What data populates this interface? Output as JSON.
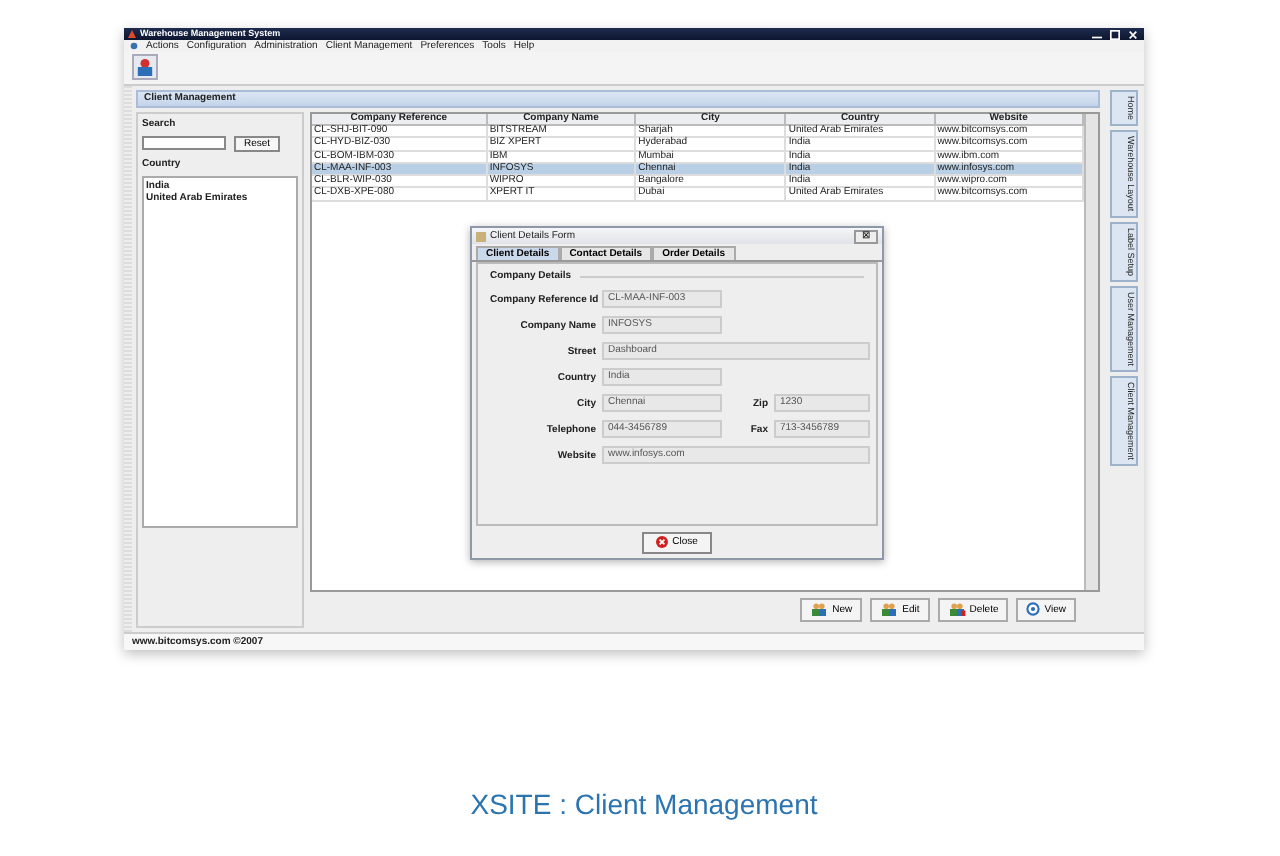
{
  "window": {
    "title": "Warehouse Management System"
  },
  "menu": [
    "Actions",
    "Configuration",
    "Administration",
    "Client Management",
    "Preferences",
    "Tools",
    "Help"
  ],
  "panel_title": "Client Management",
  "search": {
    "label": "Search",
    "button": "Reset"
  },
  "country_filter": {
    "label": "Country",
    "items": [
      "India",
      "United Arab Emirates"
    ]
  },
  "table": {
    "columns": [
      "Company Reference",
      "Company Name",
      "City",
      "Country",
      "Website"
    ],
    "rows": [
      {
        "cells": [
          "CL-SHJ-BIT-090",
          "BITSTREAM",
          "Sharjah",
          "United Arab Emirates",
          "www.bitcomsys.com"
        ],
        "selected": false
      },
      {
        "cells": [
          "CL-HYD-BIZ-030",
          "BIZ XPERT",
          "Hyderabad",
          "India",
          "www.bitcomsys.com"
        ],
        "selected": false
      },
      {
        "cells": [
          "CL-BOM-IBM-030",
          "IBM",
          "Mumbai",
          "India",
          "www.ibm.com"
        ],
        "selected": false
      },
      {
        "cells": [
          "CL-MAA-INF-003",
          "INFOSYS",
          "Chennai",
          "India",
          "www.infosys.com"
        ],
        "selected": true
      },
      {
        "cells": [
          "CL-BLR-WIP-030",
          "WIPRO",
          "Bangalore",
          "India",
          "www.wipro.com"
        ],
        "selected": false
      },
      {
        "cells": [
          "CL-DXB-XPE-080",
          "XPERT IT",
          "Dubai",
          "United Arab Emirates",
          "www.bitcomsys.com"
        ],
        "selected": false
      }
    ]
  },
  "dialog": {
    "title": "Client Details Form",
    "close_glyph": "⊠",
    "tabs": [
      {
        "label": "Client Details",
        "selected": true
      },
      {
        "label": "Contact Details",
        "selected": false
      },
      {
        "label": "Order Details",
        "selected": false
      }
    ],
    "group": "Company Details",
    "rows": [
      {
        "kind": "short",
        "fields": [
          {
            "label": "Company Reference Id",
            "value": "CL-MAA-INF-003"
          }
        ]
      },
      {
        "kind": "short",
        "fields": [
          {
            "label": "Company Name",
            "value": "INFOSYS"
          }
        ]
      },
      {
        "kind": "wide",
        "fields": [
          {
            "label": "Street",
            "value": "Dashboard"
          }
        ]
      },
      {
        "kind": "short",
        "fields": [
          {
            "label": "Country",
            "value": "India"
          }
        ]
      },
      {
        "kind": "pair",
        "fields": [
          {
            "label": "City",
            "value": "Chennai"
          },
          {
            "label": "Zip",
            "value": "1230"
          }
        ]
      },
      {
        "kind": "pair",
        "fields": [
          {
            "label": "Telephone",
            "value": "044-3456789"
          },
          {
            "label": "Fax",
            "value": "713-3456789"
          }
        ]
      },
      {
        "kind": "wide",
        "fields": [
          {
            "label": "Website",
            "value": "www.infosys.com"
          }
        ]
      }
    ],
    "button": "Close"
  },
  "actions": [
    {
      "label": "New",
      "kind": "new"
    },
    {
      "label": "Edit",
      "kind": "edit"
    },
    {
      "label": "Delete",
      "kind": "delete"
    },
    {
      "label": "View",
      "kind": "view"
    }
  ],
  "side_tabs": [
    "Home",
    "Warehouse Layout",
    "Label Setup",
    "User Management",
    "Client Management"
  ],
  "status_bar": "www.bitcomsys.com ©2007",
  "caption": "XSITE : Client Management"
}
